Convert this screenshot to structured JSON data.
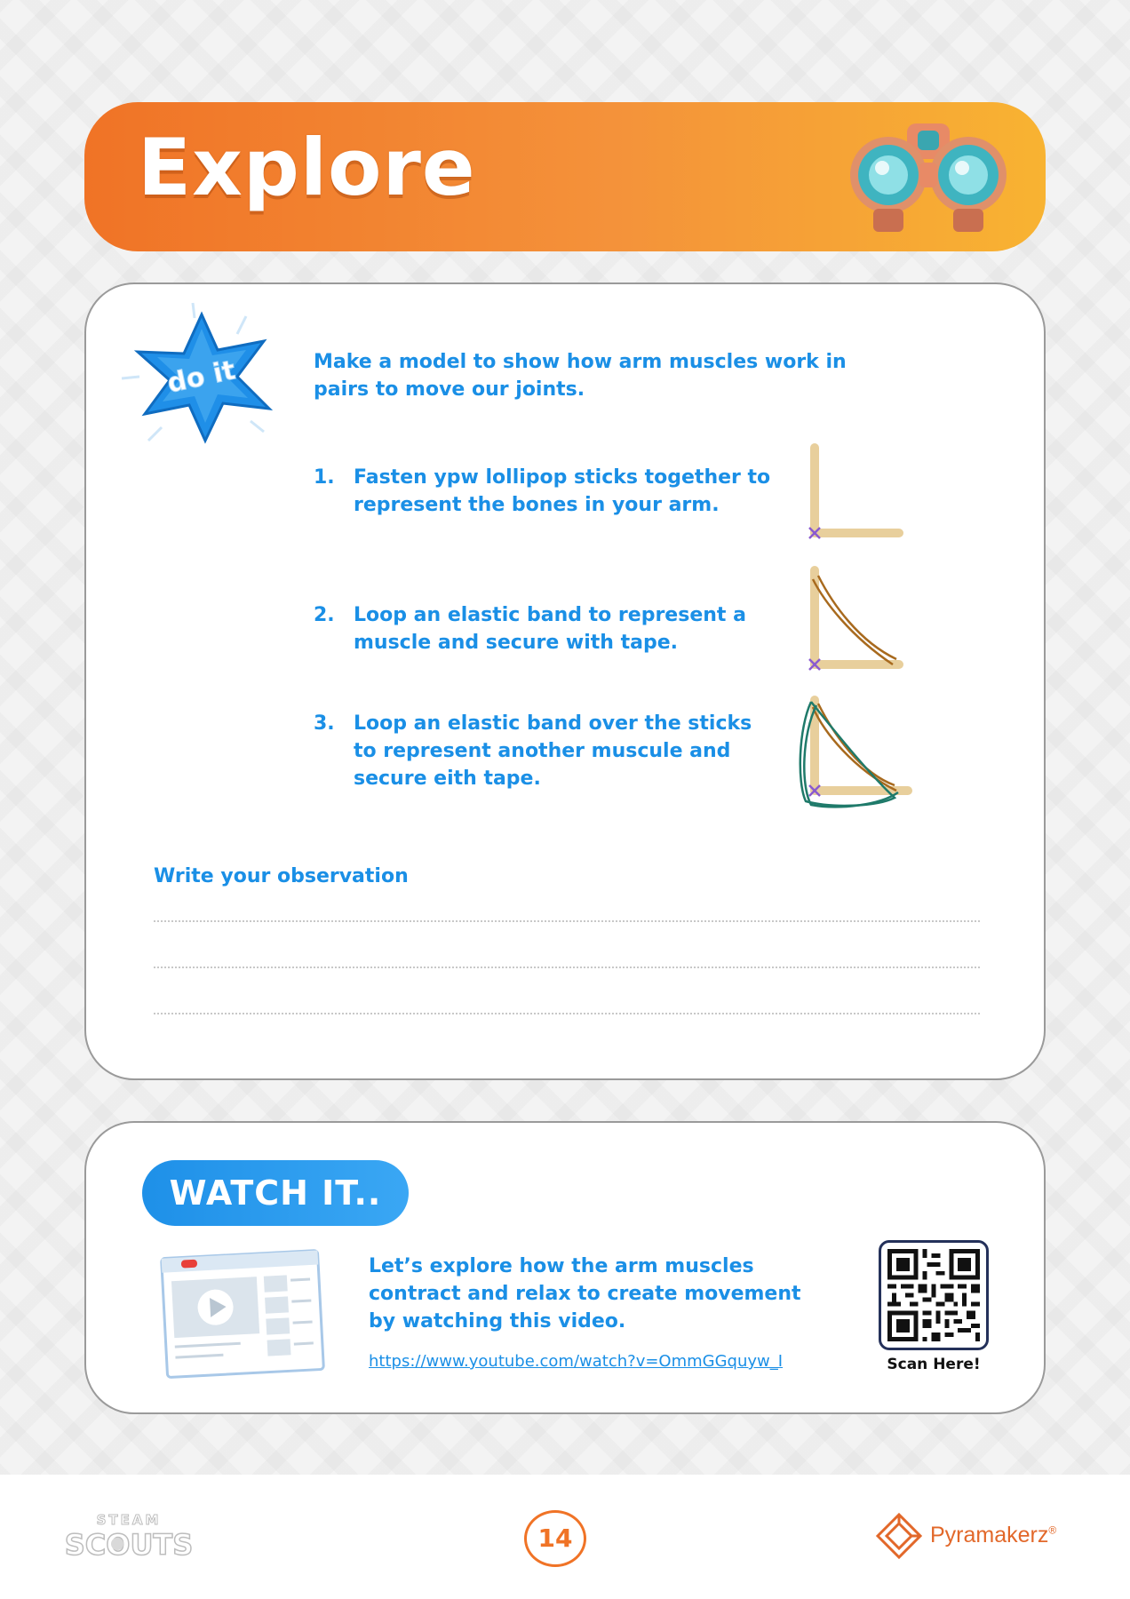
{
  "header": {
    "title": "Explore"
  },
  "doit": {
    "badge": "do it",
    "intro": "Make a model to show how arm muscles work in pairs to move our joints.",
    "steps": [
      {
        "num": "1.",
        "text": "Fasten ypw lollipop sticks together to represent the bones in your arm."
      },
      {
        "num": "2.",
        "text": "Loop an elastic band to represent a muscle and secure with tape."
      },
      {
        "num": "3.",
        "text": "Loop an elastic band over the sticks to represent another muscule and secure eith tape."
      }
    ],
    "observation_label": "Write your observation"
  },
  "watch": {
    "pill": "WATCH IT..",
    "description": "Let’s explore how the arm muscles contract and relax to create movement by watching this video.",
    "link": "https://www.youtube.com/watch?v=OmmGGquyw_I",
    "qr_caption": "Scan Here!"
  },
  "footer": {
    "steam_top": "STEAM",
    "steam_bottom": "SCOUTS",
    "page_number": "14",
    "brand": "Pyramakerz",
    "brand_mark": "®"
  },
  "colors": {
    "orange": "#f07326",
    "blue": "#1a8fe6",
    "stick": "#e8cf9c",
    "band_brown": "#a86a1e",
    "band_green": "#1f7a6a"
  }
}
